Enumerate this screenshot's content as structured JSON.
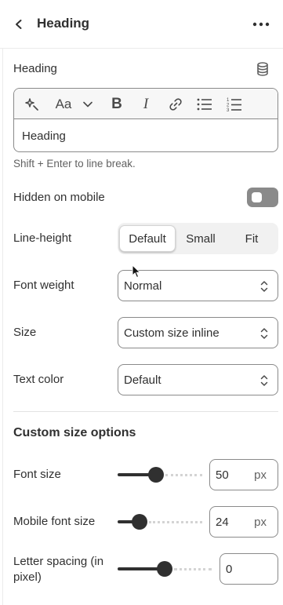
{
  "header": {
    "title": "Heading"
  },
  "heading_field": {
    "label": "Heading",
    "value": "Heading",
    "hint": "Shift + Enter to line break."
  },
  "toolbar": {
    "icons": [
      "magic-icon",
      "font-size-icon",
      "chevron-down-icon",
      "bold-icon",
      "italic-icon",
      "link-icon",
      "bullet-list-icon",
      "numbered-list-icon"
    ]
  },
  "hidden_on_mobile": {
    "label": "Hidden on mobile",
    "on": false
  },
  "line_height": {
    "label": "Line-height",
    "options": [
      "Default",
      "Small",
      "Fit"
    ],
    "selected": "Default"
  },
  "font_weight": {
    "label": "Font weight",
    "value": "Normal"
  },
  "size": {
    "label": "Size",
    "value": "Custom size inline"
  },
  "text_color": {
    "label": "Text color",
    "value": "Default"
  },
  "custom_size": {
    "title": "Custom size options",
    "font_size": {
      "label": "Font size",
      "value": "50",
      "unit": "px",
      "level": 0.44
    },
    "mobile_font_size": {
      "label": "Mobile font size",
      "value": "24",
      "unit": "px",
      "level": 0.21
    },
    "letter_spacing": {
      "label_line1": "Letter spacing (in",
      "label_line2": "pixel)",
      "value": "0",
      "level": 0.5
    }
  },
  "colors": {
    "text": "#303030",
    "muted": "#616161",
    "border": "#8a8a8a",
    "slider": "#303030"
  }
}
